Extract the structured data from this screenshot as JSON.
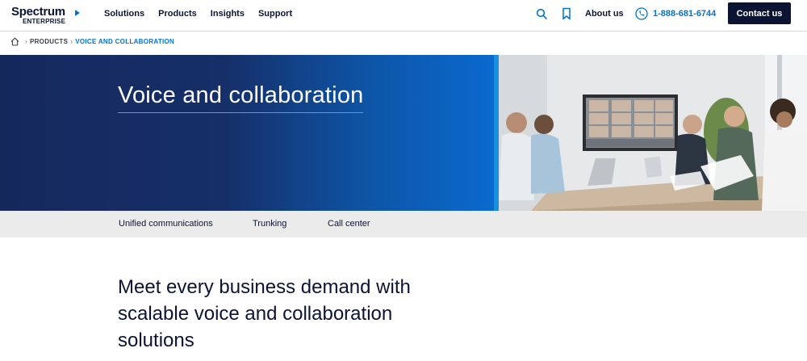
{
  "header": {
    "logo_brand": "Spectrum",
    "logo_sub": "ENTERPRISE",
    "nav": [
      "Solutions",
      "Products",
      "Insights",
      "Support"
    ],
    "about": "About us",
    "phone": "1-888-681-6744",
    "contact": "Contact us"
  },
  "breadcrumb": {
    "items": [
      "PRODUCTS",
      "VOICE AND COLLABORATION"
    ]
  },
  "hero": {
    "title": "Voice and collaboration"
  },
  "subnav": {
    "items": [
      "Unified communications",
      "Trunking",
      "Call center"
    ]
  },
  "main": {
    "headline": "Meet every business demand with scalable voice and collaboration solutions"
  },
  "colors": {
    "navy": "#0b1533",
    "accent_blue": "#0073d1",
    "subnav_bg": "#ebebeb"
  }
}
